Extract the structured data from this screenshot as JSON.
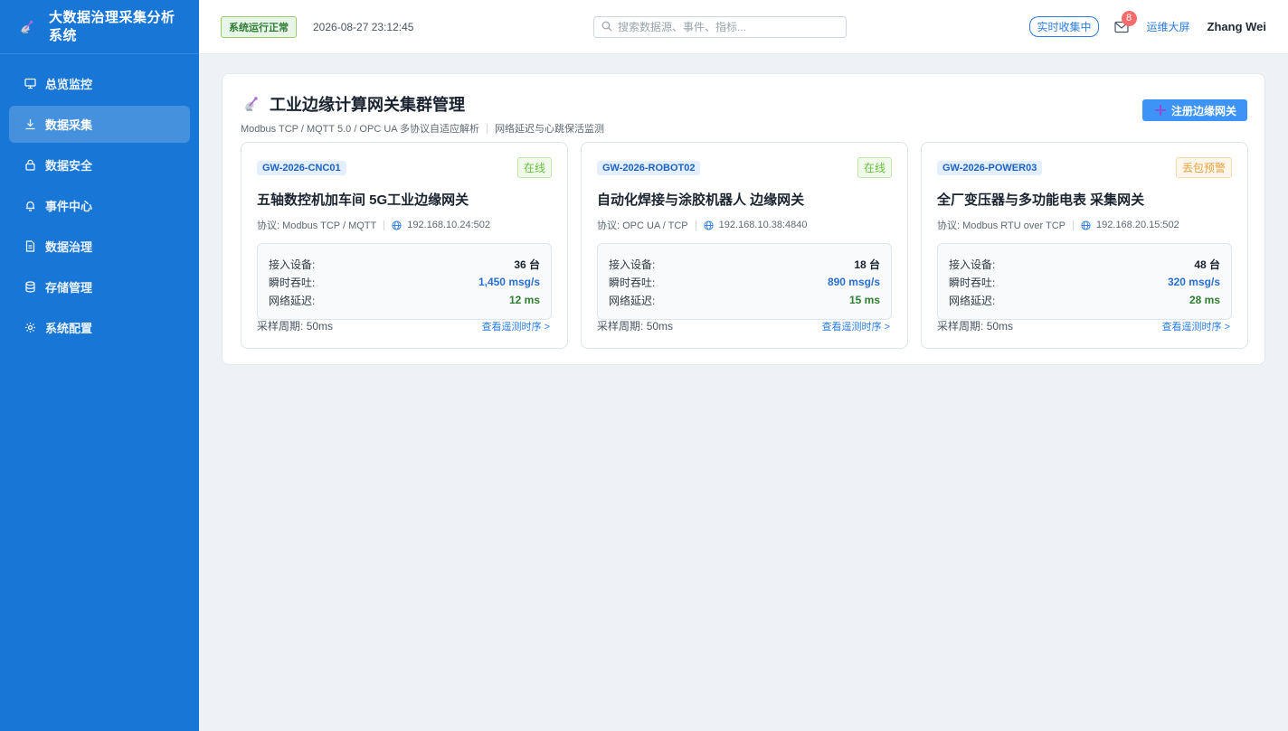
{
  "app": {
    "title": "大数据治理采集分析系统"
  },
  "sidebar": {
    "items": [
      {
        "label": "总览监控",
        "icon": "monitor-icon",
        "active": false
      },
      {
        "label": "数据采集",
        "icon": "download-icon",
        "active": true
      },
      {
        "label": "数据安全",
        "icon": "lock-icon",
        "active": false
      },
      {
        "label": "事件中心",
        "icon": "bell-icon",
        "active": false
      },
      {
        "label": "数据治理",
        "icon": "document-icon",
        "active": false
      },
      {
        "label": "存储管理",
        "icon": "database-icon",
        "active": false
      },
      {
        "label": "系统配置",
        "icon": "gear-icon",
        "active": false
      }
    ]
  },
  "header": {
    "status": "系统运行正常",
    "datetime": "2026-08-27 23:12:45",
    "search_placeholder": "搜索数据源、事件、指标...",
    "realtime": "实时收集中",
    "mail_count": "8",
    "ops_link": "运维大屏",
    "user": "Zhang Wei"
  },
  "panel": {
    "title": "工业边缘计算网关集群管理",
    "subtitle_a": "Modbus TCP / MQTT 5.0 / OPC UA 多协议自适应解析",
    "subtitle_b": "网络延迟与心跳保活监测",
    "register_button": "注册边缘网关"
  },
  "labels": {
    "devices": "接入设备:",
    "throughput": "瞬时吞吐:",
    "latency": "网络延迟:",
    "period": "采样周期:",
    "view_trend": "查看遥测时序 >"
  },
  "gateways": [
    {
      "id": "GW-2026-CNC01",
      "status": "在线",
      "status_type": "ok",
      "name": "五轴数控机加车间 5G工业边缘网关",
      "protocol": "协议: Modbus TCP / MQTT",
      "address": "192.168.10.24:502",
      "devices": "36 台",
      "throughput": "1,450 msg/s",
      "latency": "12 ms",
      "period": "50ms"
    },
    {
      "id": "GW-2026-ROBOT02",
      "status": "在线",
      "status_type": "ok",
      "name": "自动化焊接与涂胶机器人 边缘网关",
      "protocol": "协议: OPC UA / TCP",
      "address": "192.168.10.38:4840",
      "devices": "18 台",
      "throughput": "890 msg/s",
      "latency": "15 ms",
      "period": "50ms"
    },
    {
      "id": "GW-2026-POWER03",
      "status": "丢包预警",
      "status_type": "warn",
      "name": "全厂变压器与多功能电表 采集网关",
      "protocol": "协议: Modbus RTU over TCP",
      "address": "192.168.20.15:502",
      "devices": "48 台",
      "throughput": "320 msg/s",
      "latency": "28 ms",
      "period": "50ms"
    }
  ]
}
